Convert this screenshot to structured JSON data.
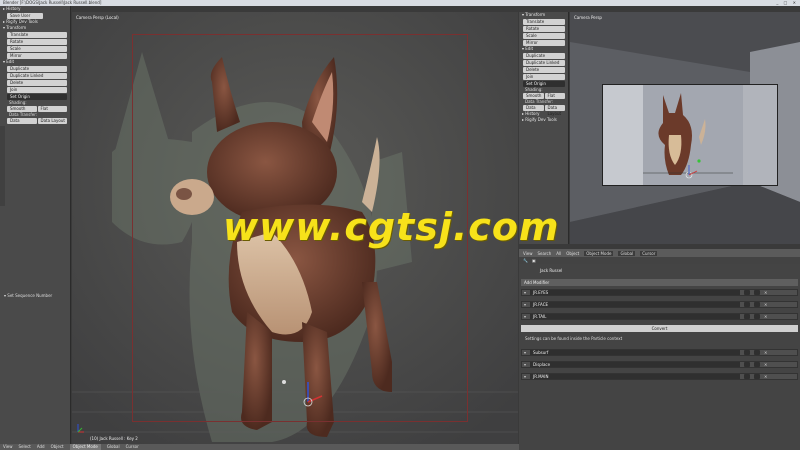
{
  "titlebar": {
    "title": "Blender [F:\\DOGS\\Jack Russell\\Jack Russell.blend]",
    "winbtns": "_ □ ✕"
  },
  "left_panel": {
    "history_header": "▸ History",
    "undo_label": "Save User Settings",
    "rigify_header": "▸ Rigify Dev Tools",
    "transform_header": "▾ Transform",
    "transform": [
      "Translate",
      "Rotate",
      "Scale",
      "Mirror"
    ],
    "edit_header": "▾ Edit",
    "edit": [
      "Duplicate",
      "Duplicate Linked",
      "Delete",
      "Join"
    ],
    "origin": "Set Origin",
    "shading_label": "Shading:",
    "smooth": "Smooth",
    "flat": "Flat",
    "datatransfer_label": "Data Transfer:",
    "data": "Data",
    "datalayout": "Data Layout",
    "operator": "▾ Set Sequence Number"
  },
  "viewport": {
    "label": "Camera Persp (Local)",
    "footer": "(10) Jack Russell : Key 2"
  },
  "right_panel": {
    "transform_header": "▾ Transform",
    "transform": [
      "Translate",
      "Rotate",
      "Scale",
      "Mirror"
    ],
    "edit_header": "▾ Edit",
    "edit": [
      "Duplicate",
      "Duplicate Linked",
      "Delete",
      "Join"
    ],
    "origin": "Set Origin",
    "shading_label": "Shading:",
    "smooth": "Smooth",
    "flat": "Flat",
    "datatransfer_label": "Data Transfer:",
    "data": "Data",
    "datalayout": "Data Layout",
    "history_header": "▸ History",
    "rigify_header": "▸ Rigify Dev Tools"
  },
  "camvp": {
    "label": "Camera Persp"
  },
  "bottombar": {
    "view": "View",
    "select": "Select",
    "add": "Add",
    "object": "Object",
    "mode": "Object Mode",
    "pivot": "Global",
    "layer": "Cursor"
  },
  "prop_header": {
    "view": "View",
    "search": "Search",
    "all": "All",
    "object": "Object",
    "mode": "Object Mode",
    "global": "Global",
    "cursor": "Cursor"
  },
  "object_name": "Jack Russel",
  "add_modifier": "Add Modifier",
  "modifiers": [
    {
      "name": "JR.EYES"
    },
    {
      "name": "JR.FACE"
    },
    {
      "name": "JR.TAIL"
    }
  ],
  "convert_label": "Convert",
  "settings_text": "Settings can be found inside the Particle context",
  "modifiers2": [
    {
      "name": "Subsurf"
    },
    {
      "name": "Displace"
    },
    {
      "name": "JR.MAIN"
    }
  ],
  "watermark": "www.cgtsj.com",
  "colors": {
    "accent": "#f7e21a",
    "fur": "#6b3a2a",
    "belly": "#c9a98a"
  }
}
